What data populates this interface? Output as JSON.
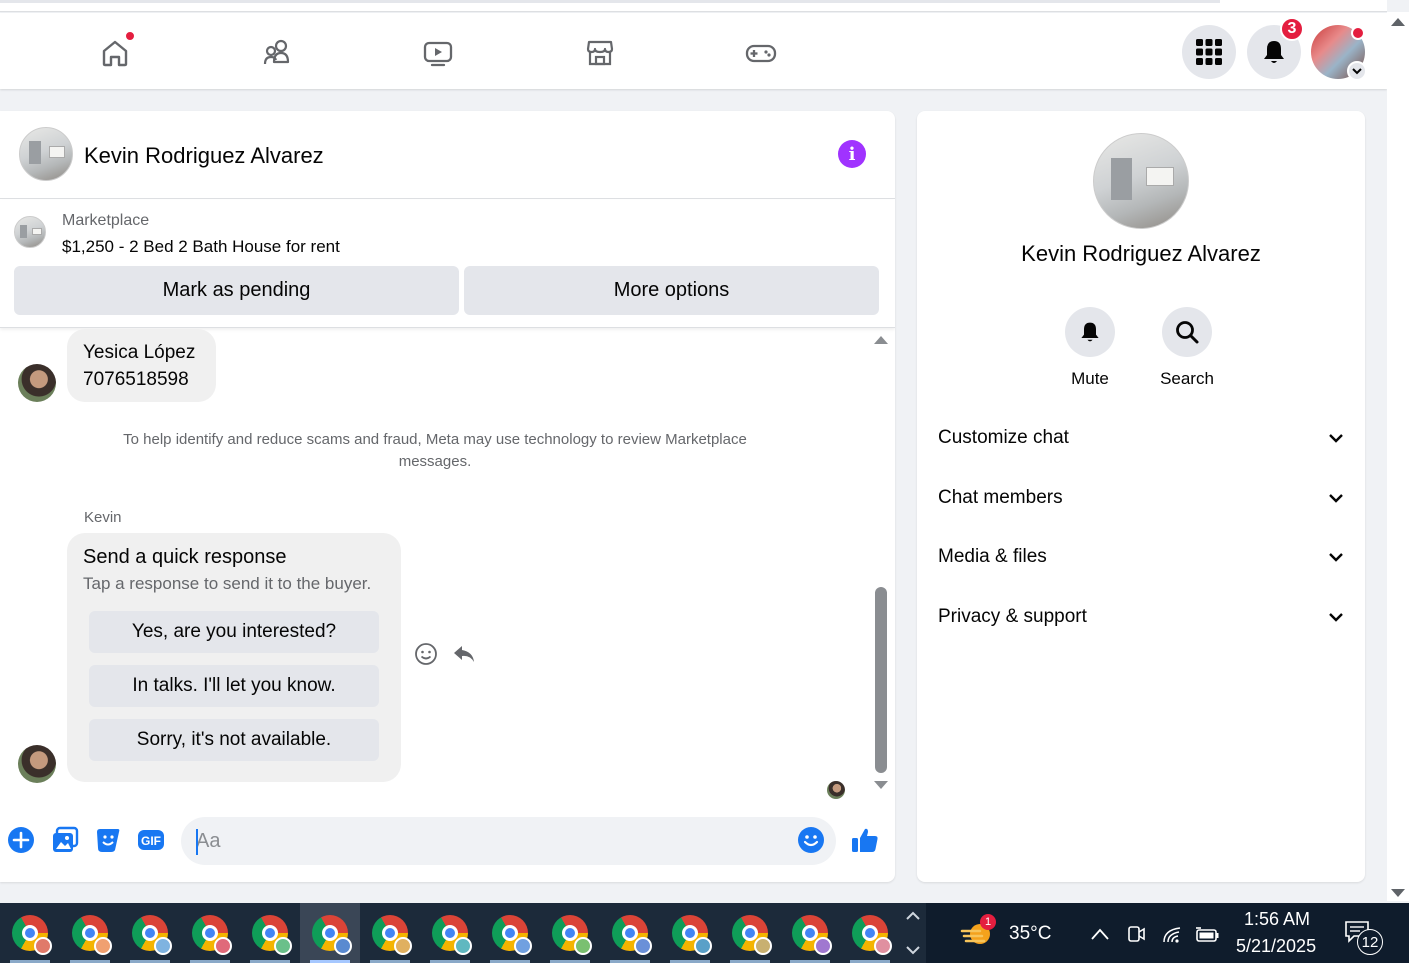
{
  "navbar": {
    "tabs": [
      "home-icon",
      "friends-icon",
      "watch-icon",
      "marketplace-icon",
      "gaming-icon"
    ],
    "notifications_count": "3"
  },
  "chat": {
    "contact_name": "Kevin Rodriguez Alvarez",
    "listing": {
      "label": "Marketplace",
      "title": "$1,250 - 2 Bed 2 Bath House for rent",
      "mark_pending": "Mark as pending",
      "more_options": "More options"
    },
    "messages": {
      "contact_line1": "Yesica López",
      "contact_line2": "7076518598",
      "notice": "To help identify and reduce scams and fraud, Meta may use technology to review Marketplace messages.",
      "sender": "Kevin",
      "quick_title": "Send a quick response",
      "quick_subtitle": "Tap a response to send it to the buyer.",
      "quick_options": [
        "Yes, are you interested?",
        "In talks. I'll let you know.",
        "Sorry, it's not available."
      ]
    },
    "composer": {
      "placeholder": "Aa"
    }
  },
  "details": {
    "name": "Kevin Rodriguez Alvarez",
    "mute_label": "Mute",
    "search_label": "Search",
    "sections": [
      "Customize chat",
      "Chat members",
      "Media & files",
      "Privacy & support"
    ]
  },
  "taskbar": {
    "weather_temp": "35°C",
    "weather_badge": "1",
    "time": "1:56 AM",
    "date": "5/21/2025",
    "notification_count": "12"
  },
  "colors": {
    "accent_blue": "#1877f2",
    "info_purple": "#a033ff",
    "badge_red": "#e41e3f"
  }
}
